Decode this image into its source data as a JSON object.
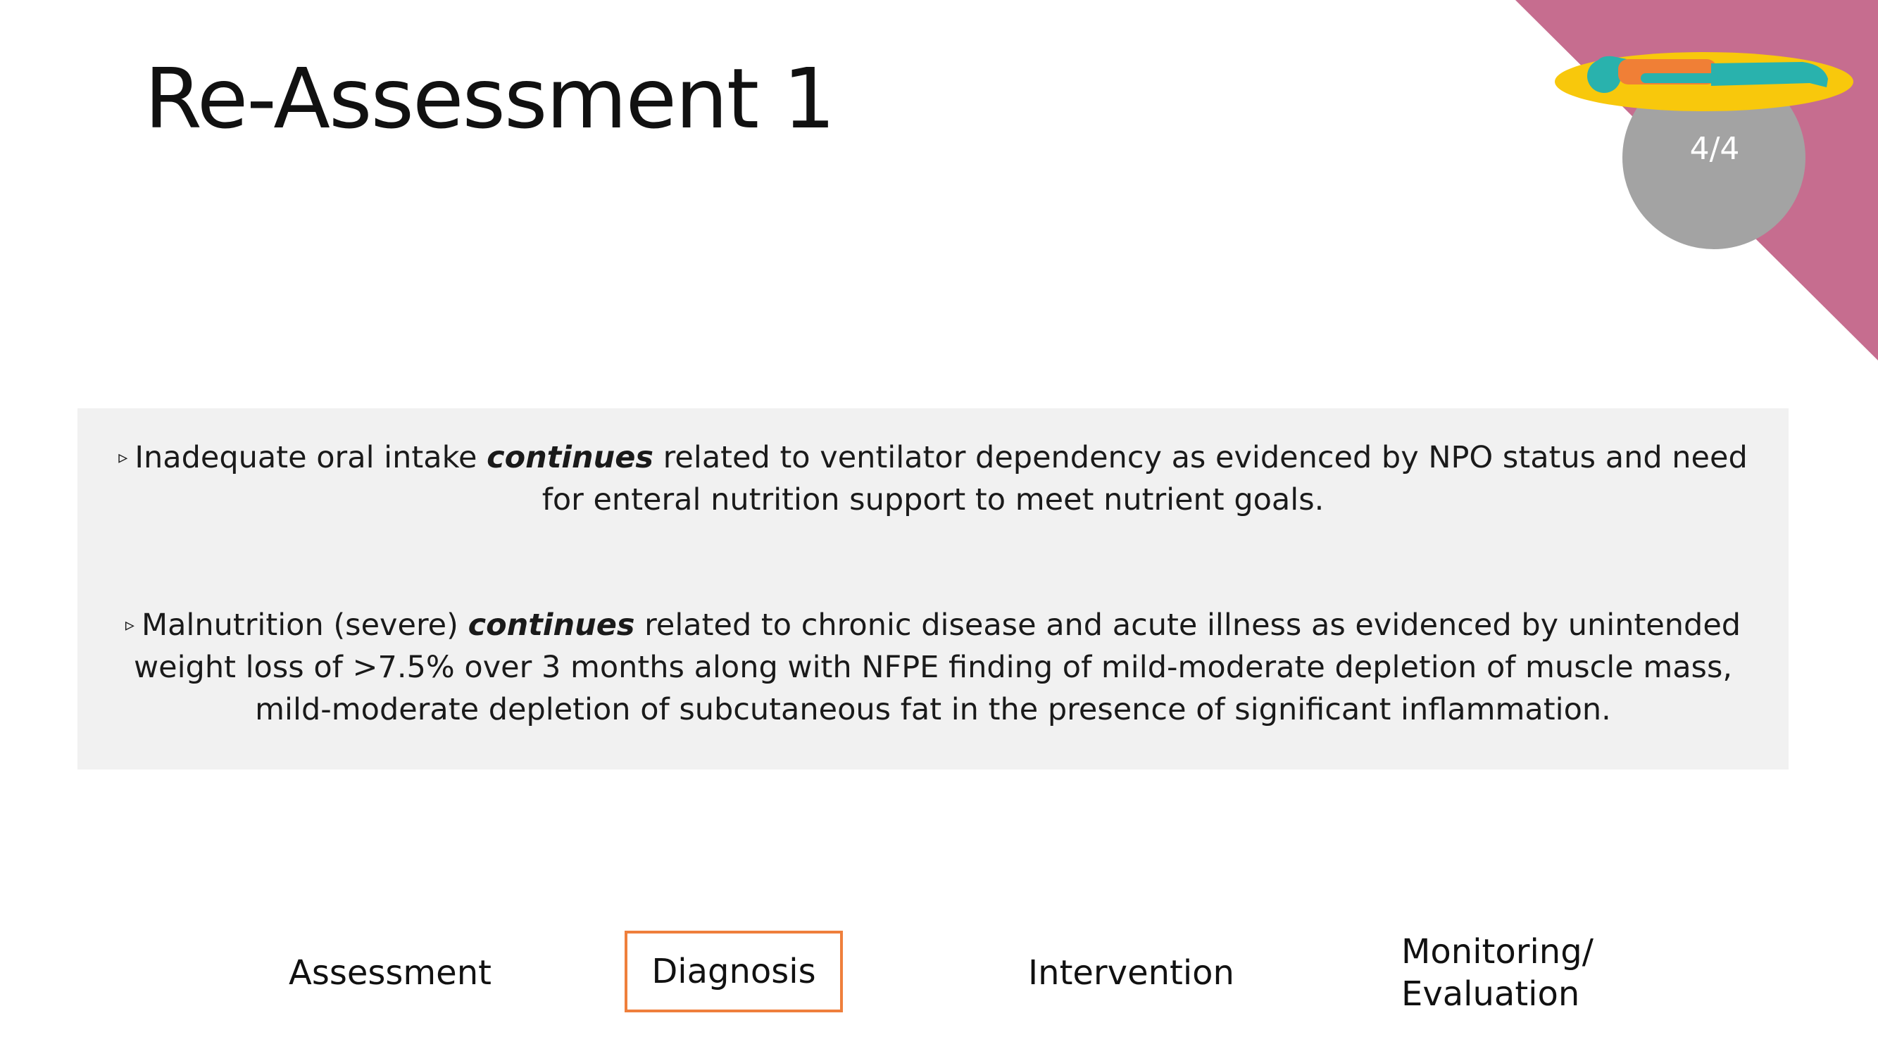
{
  "slide": {
    "title": "Re-Assessment 1",
    "page_counter": "4/4"
  },
  "colors": {
    "corner_triangle": "#c66d8f",
    "counter_circle": "#a3a3a3",
    "patient_platform": "#f8c80c",
    "patient_body": "#29b2ad",
    "patient_torso": "#f07f36",
    "content_box_bg": "#f1f1f1",
    "highlight_border": "#ef7f3c"
  },
  "icons": {
    "patient_illustration": "patient-lying-icon",
    "bullet": "triangle-bullet-icon"
  },
  "content": {
    "items": [
      {
        "bullet": "▹",
        "before": "Inadequate oral intake ",
        "emphasis": "continues",
        "after": " related to ventilator dependency as evidenced by NPO status and need for enteral nutrition support to meet nutrient goals."
      },
      {
        "bullet": "▹",
        "before": "Malnutrition (severe) ",
        "emphasis": "continues",
        "after": " related to chronic disease and acute illness as evidenced by unintended weight loss of >7.5% over 3 months along with NFPE finding of  mild-moderate depletion of muscle mass, mild-moderate depletion of subcutaneous fat in the presence of significant inflammation."
      }
    ]
  },
  "process_nav": {
    "active": "Diagnosis",
    "assessment": "Assessment",
    "diagnosis": "Diagnosis",
    "intervention": "Intervention",
    "monitoring_line1": "Monitoring/",
    "monitoring_line2": "Evaluation"
  }
}
